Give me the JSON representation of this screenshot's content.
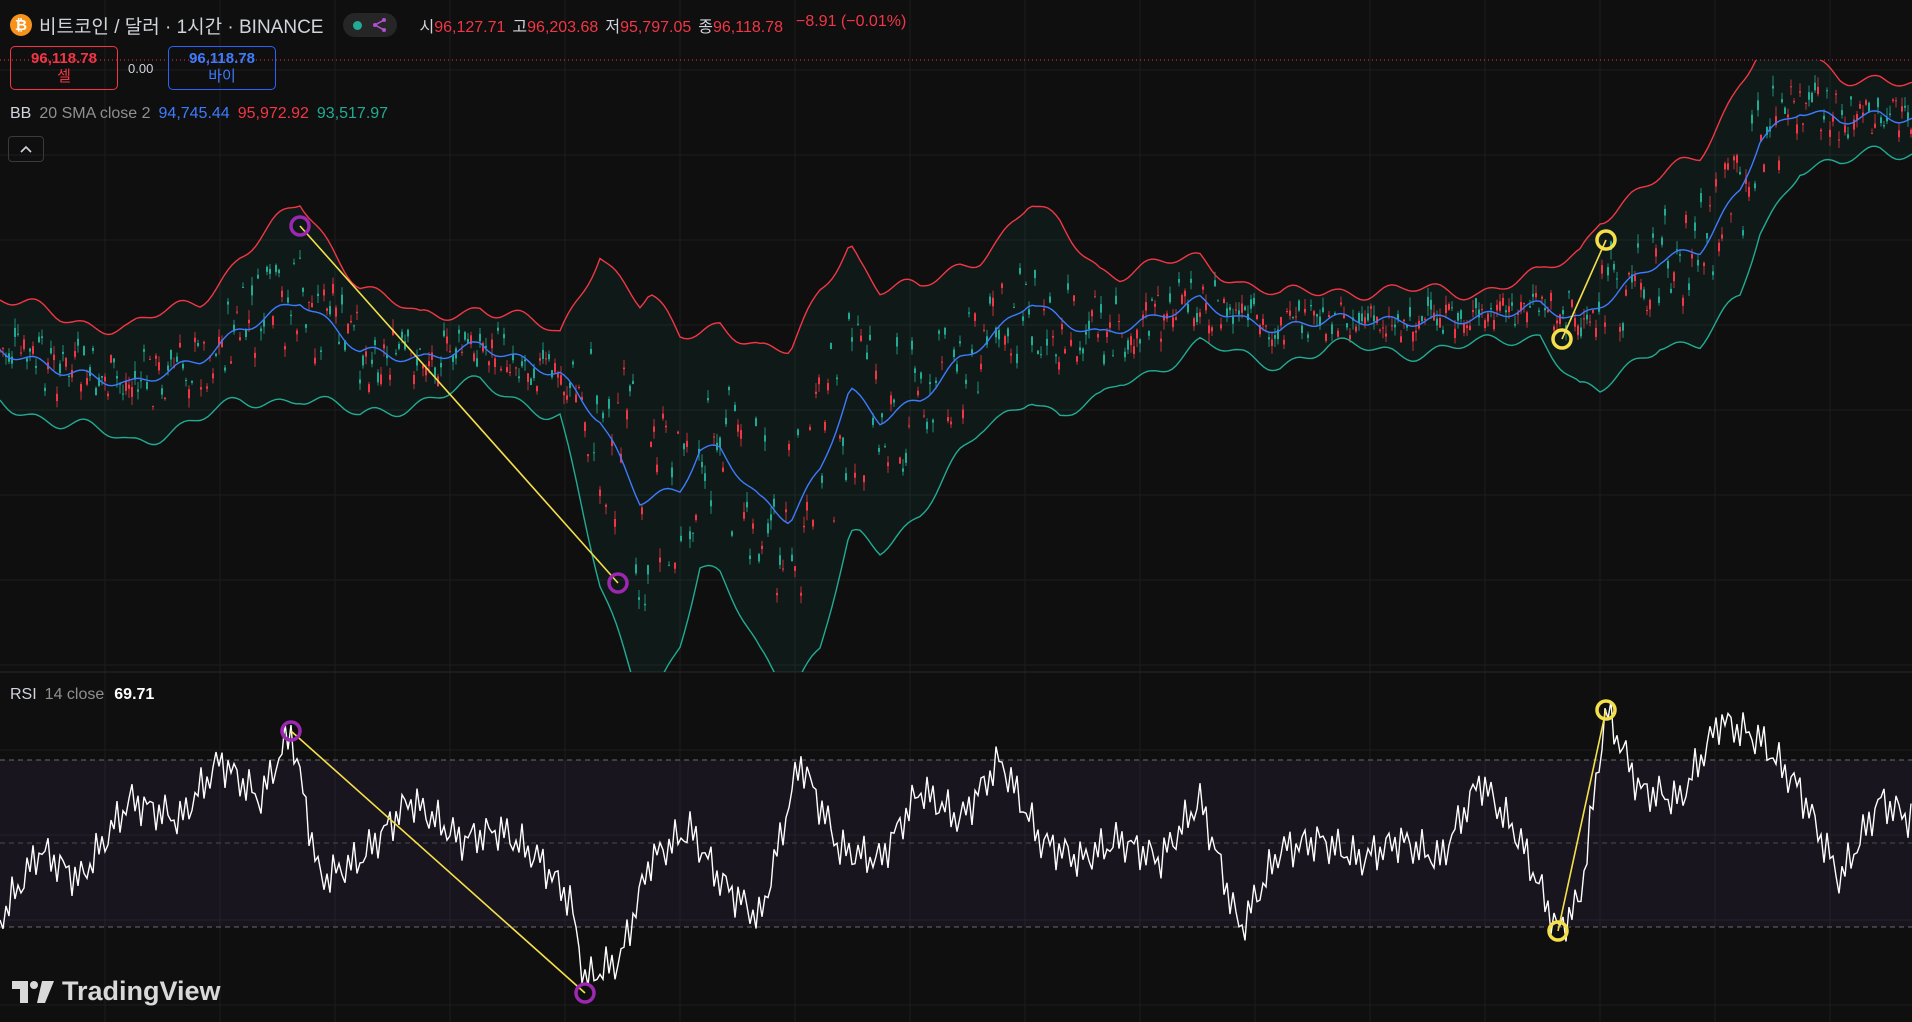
{
  "header": {
    "coin_icon_glyph": "₿",
    "symbol_title": "비트코인 / 달러 · 1시간 · BINANCE",
    "ohlc": {
      "open_label": "시",
      "open": "96,127.71",
      "high_label": "고",
      "high": "96,203.68",
      "low_label": "저",
      "low": "95,797.05",
      "close_label": "종",
      "close": "96,118.78",
      "change": "−8.91 (−0.01%)"
    },
    "market_status_color": "#22ab94",
    "share_icon_color": "#b04fcf"
  },
  "trade": {
    "sell_price": "96,118.78",
    "sell_label": "셀",
    "spread": "0.00",
    "buy_price": "96,118.78",
    "buy_label": "바이"
  },
  "bb_legend": {
    "name": "BB",
    "params": "20 SMA close 2",
    "basis": "94,745.44",
    "upper": "95,972.92",
    "lower": "93,517.97"
  },
  "rsi_legend": {
    "name": "RSI",
    "params": "14 close",
    "value": "69.71"
  },
  "branding": {
    "name": "TradingView"
  },
  "colors": {
    "up": "#22ab94",
    "down": "#f23645",
    "basis": "#3d7bff",
    "upper": "#f23645",
    "lower": "#22ab94",
    "rsi": "#ffffff",
    "drawing_line": "#f5e04a",
    "marker_purple": "#9c27b0",
    "marker_yellow": "#f5e04a"
  },
  "icons": {
    "coin": "bitcoin-icon",
    "share": "share-icon",
    "collapse": "chevron-up-icon",
    "logo": "tradingview-logo-icon"
  }
}
